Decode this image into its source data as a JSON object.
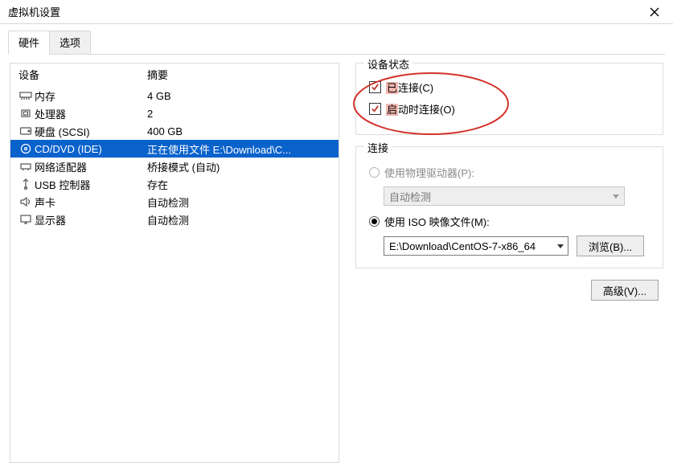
{
  "window": {
    "title": "虚拟机设置"
  },
  "tabs": {
    "hardware": "硬件",
    "options": "选项"
  },
  "deviceList": {
    "header_device": "设备",
    "header_summary": "摘要",
    "items": [
      {
        "name": "内存",
        "summary": "4 GB"
      },
      {
        "name": "处理器",
        "summary": "2"
      },
      {
        "name": "硬盘 (SCSI)",
        "summary": "400 GB"
      },
      {
        "name": "CD/DVD (IDE)",
        "summary": "正在使用文件 E:\\Download\\C..."
      },
      {
        "name": "网络适配器",
        "summary": "桥接模式 (自动)"
      },
      {
        "name": "USB 控制器",
        "summary": "存在"
      },
      {
        "name": "声卡",
        "summary": "自动检测"
      },
      {
        "name": "显示器",
        "summary": "自动检测"
      }
    ]
  },
  "status": {
    "legend": "设备状态",
    "connected_label_pre": "已",
    "connected_label_post": "连接(C)",
    "connect_at_poweron_pre": "启",
    "connect_at_poweron_post": "动时连接(O)"
  },
  "connection": {
    "legend": "连接",
    "use_physical_label": "使用物理驱动器(P):",
    "physical_value": "自动检测",
    "use_iso_label": "使用 ISO 映像文件(M):",
    "iso_value": "E:\\Download\\CentOS-7-x86_64",
    "browse_label": "浏览(B)..."
  },
  "advanced_label": "高级(V)..."
}
